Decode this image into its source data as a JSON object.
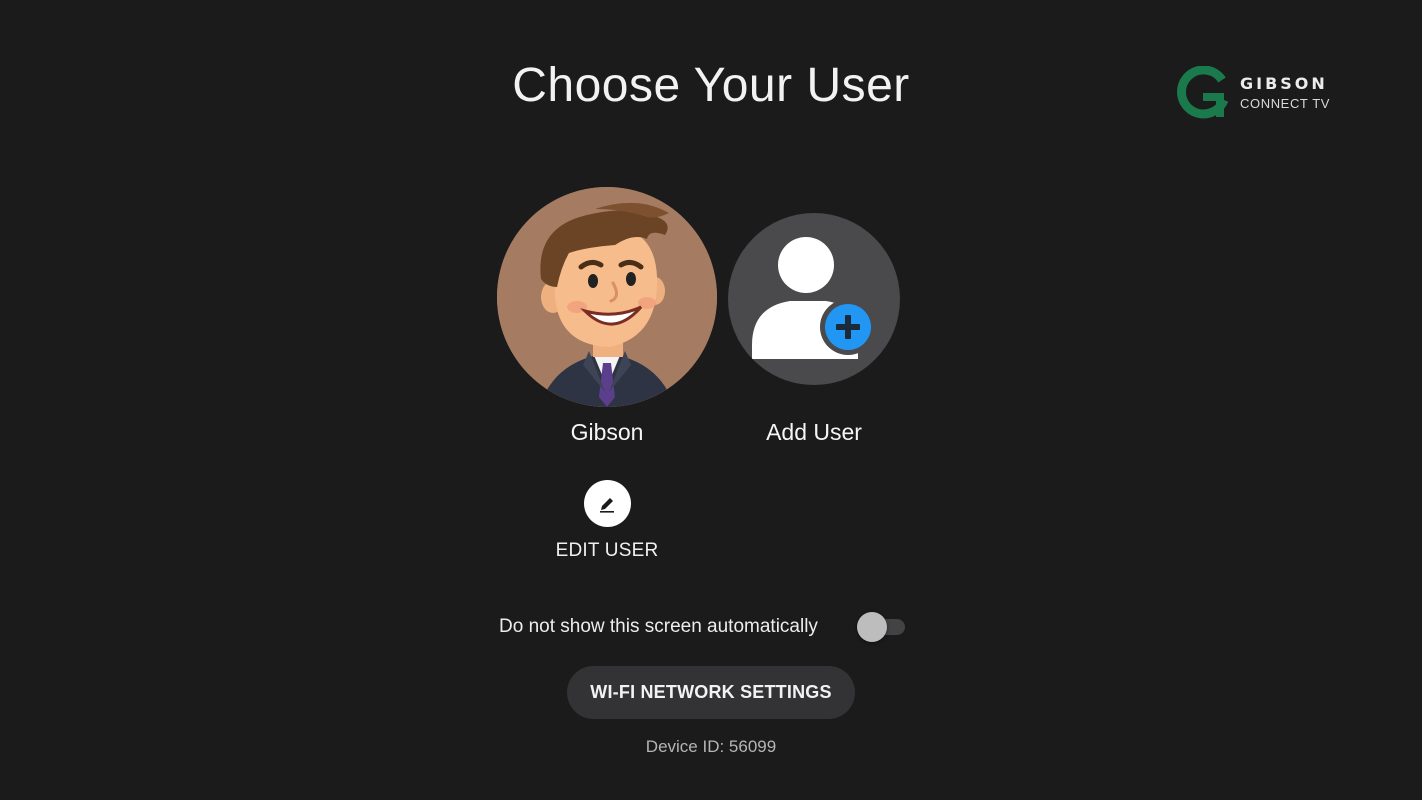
{
  "header": {
    "title": "Choose Your User",
    "logo": {
      "name": "GIBSON",
      "subtitle": "CONNECT TV",
      "mark_color": "#1a7a4c"
    }
  },
  "users": [
    {
      "name": "Gibson",
      "avatar": "cartoon-man-avatar"
    }
  ],
  "add_user": {
    "label": "Add User",
    "icon": "person-add-icon",
    "badge_color": "#2196f3"
  },
  "edit_user": {
    "label": "EDIT USER",
    "icon": "pencil-icon"
  },
  "auto_show": {
    "label": "Do not show this screen automatically",
    "enabled": false
  },
  "wifi_button": {
    "label": "WI-FI NETWORK SETTINGS"
  },
  "device": {
    "id_text": "Device ID: 56099"
  }
}
